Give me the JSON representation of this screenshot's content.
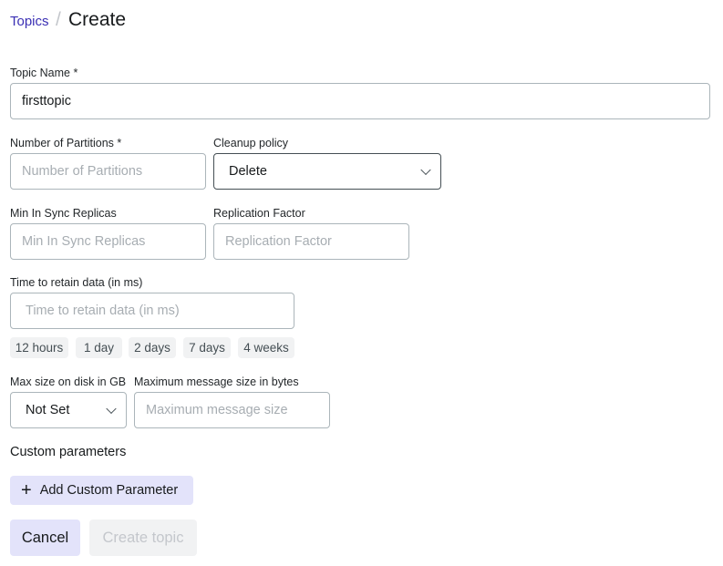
{
  "breadcrumb": {
    "parent": "Topics",
    "separator": "/",
    "current": "Create"
  },
  "form": {
    "topic_name": {
      "label": "Topic Name *",
      "value": "firsttopic"
    },
    "partitions": {
      "label": "Number of Partitions *",
      "placeholder": "Number of Partitions"
    },
    "cleanup_policy": {
      "label": "Cleanup policy",
      "value": "Delete"
    },
    "min_isr": {
      "label": "Min In Sync Replicas",
      "placeholder": "Min In Sync Replicas"
    },
    "replication": {
      "label": "Replication Factor",
      "placeholder": "Replication Factor"
    },
    "retention": {
      "label": "Time to retain data (in ms)",
      "placeholder": "Time to retain data (in ms)",
      "presets": [
        "12 hours",
        "1 day",
        "2 days",
        "7 days",
        "4 weeks"
      ]
    },
    "max_disk": {
      "label": "Max size on disk in GB",
      "value": "Not Set"
    },
    "max_message": {
      "label": "Maximum message size in bytes",
      "placeholder": "Maximum message size"
    }
  },
  "custom_params": {
    "title": "Custom parameters",
    "add_label": "Add Custom Parameter",
    "add_icon": "plus-icon"
  },
  "actions": {
    "cancel": "Cancel",
    "create": "Create topic"
  }
}
